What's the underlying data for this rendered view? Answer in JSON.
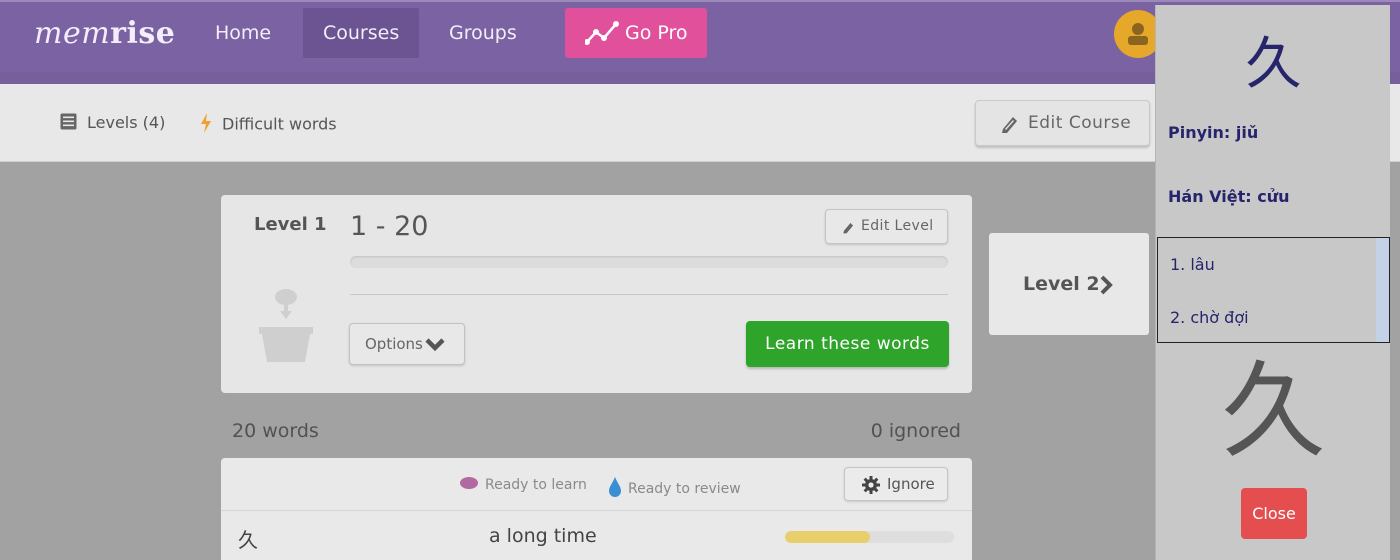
{
  "nav": {
    "logo_light": "mem",
    "logo_bold": "rise",
    "items": [
      "Home",
      "Courses",
      "Groups"
    ],
    "active": "Courses",
    "go_pro": "Go Pro"
  },
  "subnav": {
    "levels": "Levels (4)",
    "difficult": "Difficult words",
    "edit_course": "Edit Course"
  },
  "level_card": {
    "title": "Level 1",
    "range": "1 - 20",
    "edit_level": "Edit Level",
    "options": "Options",
    "learn": "Learn these words"
  },
  "next_level": "Level 2",
  "counts": {
    "words": "20 words",
    "ignored": "0 ignored"
  },
  "words_table": {
    "legend_learn": "Ready to learn",
    "legend_review": "Ready to review",
    "ignore": "Ignore",
    "rows": [
      {
        "character": "久",
        "definition": "a long time",
        "progress": 0.5
      }
    ]
  },
  "popup": {
    "character": "久",
    "pinyin": "Pinyin: jiǔ",
    "han_viet": "Hán Việt: cửu",
    "meanings": [
      "1. lâu",
      "2. chờ đợi"
    ],
    "close": "Close"
  },
  "colors": {
    "nav_purple": "#7b62a3",
    "go_pro_pink": "#e0509b",
    "learn_green": "#2fa42b",
    "close_red": "#e44e4e",
    "popup_text": "#26246a",
    "progress_yellow": "#e8cf6c"
  },
  "icons": {
    "levels": "list-icon",
    "difficult": "lightning-icon",
    "edit": "pencil-icon",
    "options": "chevron-down-icon",
    "level2": "chevron-right-icon",
    "ignore": "gear-icon",
    "learn_legend": "seed-icon",
    "review_legend": "water-drop-icon",
    "avatar": "user-icon",
    "go_pro": "chart-line-icon"
  }
}
